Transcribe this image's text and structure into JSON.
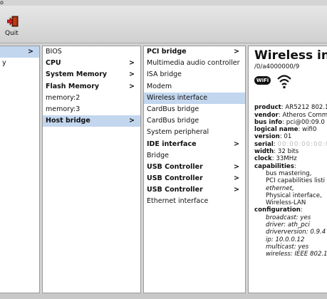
{
  "window": {
    "title_fragment": "o"
  },
  "toolbar": {
    "quit_label": "Quit"
  },
  "pane1": {
    "items": [
      {
        "label": "",
        "arrow": ">",
        "selected": true
      },
      {
        "label": "y",
        "arrow": "",
        "selected": false
      }
    ]
  },
  "pane2": {
    "items": [
      {
        "label": "BIOS",
        "bold": false,
        "arrow": ""
      },
      {
        "label": "CPU",
        "bold": true,
        "arrow": ">"
      },
      {
        "label": "System Memory",
        "bold": true,
        "arrow": ">"
      },
      {
        "label": "Flash Memory",
        "bold": true,
        "arrow": ">"
      },
      {
        "label": "memory:2",
        "bold": false,
        "arrow": ""
      },
      {
        "label": "memory:3",
        "bold": false,
        "arrow": ""
      },
      {
        "label": "Host bridge",
        "bold": true,
        "arrow": ">",
        "selected": true
      }
    ]
  },
  "pane3": {
    "items": [
      {
        "label": "PCI bridge",
        "bold": true,
        "arrow": ">"
      },
      {
        "label": "Multimedia audio controller",
        "bold": false,
        "arrow": ""
      },
      {
        "label": "ISA bridge",
        "bold": false,
        "arrow": ""
      },
      {
        "label": "Modem",
        "bold": false,
        "arrow": ""
      },
      {
        "label": "Wireless interface",
        "bold": false,
        "arrow": "",
        "selected": true
      },
      {
        "label": "CardBus bridge",
        "bold": false,
        "arrow": ""
      },
      {
        "label": "CardBus bridge",
        "bold": false,
        "arrow": ""
      },
      {
        "label": "System peripheral",
        "bold": false,
        "arrow": ""
      },
      {
        "label": "IDE interface",
        "bold": true,
        "arrow": ">"
      },
      {
        "label": "Bridge",
        "bold": false,
        "arrow": ""
      },
      {
        "label": "USB Controller",
        "bold": true,
        "arrow": ">"
      },
      {
        "label": "USB Controller",
        "bold": true,
        "arrow": ">"
      },
      {
        "label": "USB Controller",
        "bold": true,
        "arrow": ">"
      },
      {
        "label": "Ethernet interface",
        "bold": false,
        "arrow": ""
      }
    ]
  },
  "detail": {
    "title": "Wireless inte",
    "path": "/0/a4000000/9",
    "badge": "WiFi",
    "fields": [
      {
        "key": "product",
        "value": "AR5212 802.1"
      },
      {
        "key": "vendor",
        "value": "Atheros Comm"
      },
      {
        "key": "bus info",
        "value": "pci@00:09.0"
      },
      {
        "key": "logical name",
        "value": "wifi0"
      },
      {
        "key": "version",
        "value": "01"
      },
      {
        "key": "serial",
        "value": "00:00:00:00:00"
      },
      {
        "key": "width",
        "value": "32 bits"
      },
      {
        "key": "clock",
        "value": "33MHz"
      }
    ],
    "capabilities_label": "capabilities",
    "capabilities": [
      "bus mastering,",
      "PCI capabilities listi",
      "ethernet,",
      "Physical interface,",
      "Wireless-LAN"
    ],
    "configuration_label": "configuration",
    "configuration": [
      "broadcast: yes",
      "driver: ath_pci",
      "driverversion: 0.9.4",
      "ip: 10.0.0.12",
      "multicast: yes",
      "wireless: IEEE 802.1"
    ]
  }
}
